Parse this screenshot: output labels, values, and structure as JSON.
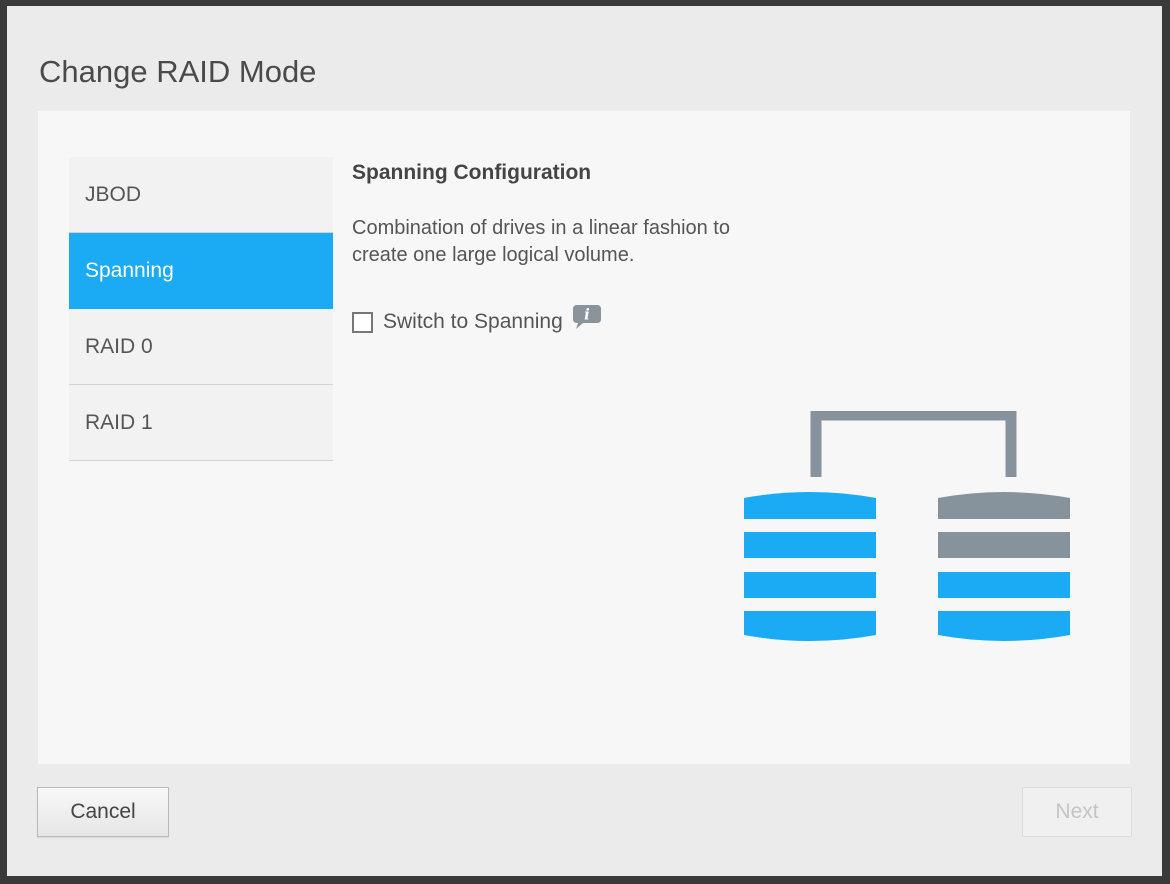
{
  "dialog": {
    "title": "Change RAID Mode"
  },
  "modes": [
    {
      "label": "JBOD",
      "active": false
    },
    {
      "label": "Spanning",
      "active": true
    },
    {
      "label": "RAID 0",
      "active": false
    },
    {
      "label": "RAID 1",
      "active": false
    }
  ],
  "details": {
    "heading": "Spanning Configuration",
    "description_line1": "Combination of drives in a linear fashion to",
    "description_line2": "create one large logical volume.",
    "checkbox_label": "Switch to Spanning",
    "checkbox_checked": false,
    "info_icon": "info-speech-bubble-icon"
  },
  "illustration": {
    "icon": "spanning-drives-diagram",
    "colors": {
      "active": "#1aabf4",
      "inactive": "#87939c"
    }
  },
  "footer": {
    "cancel_label": "Cancel",
    "next_label": "Next",
    "next_enabled": false
  },
  "colors": {
    "accent": "#1aabf4",
    "dialog_bg": "#ebebeb",
    "panel_bg": "#f7f7f7"
  }
}
